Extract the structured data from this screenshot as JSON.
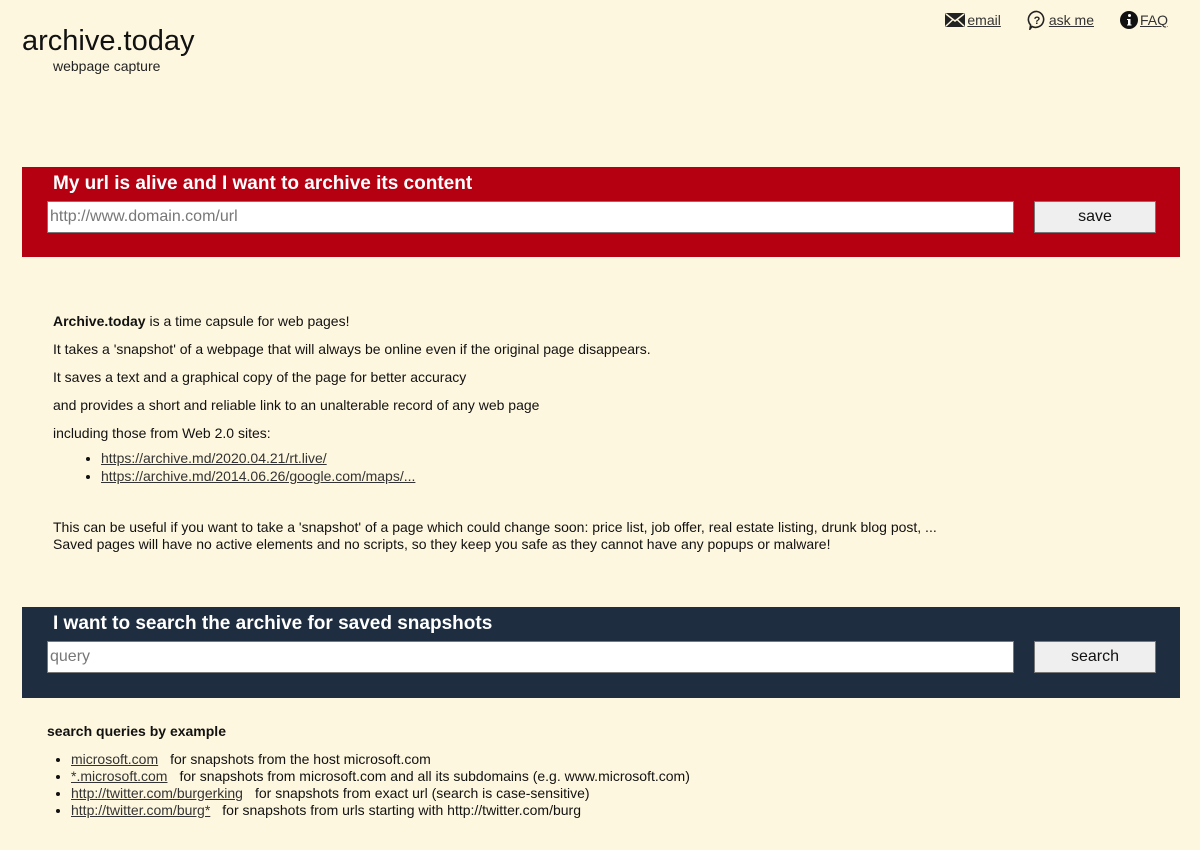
{
  "header": {
    "logo_title": "archive.today",
    "logo_subtitle": "webpage capture",
    "links": [
      {
        "icon": "envelope-icon",
        "label": "email"
      },
      {
        "icon": "question-bubble-icon",
        "label": "ask me"
      },
      {
        "icon": "info-icon",
        "label": "FAQ"
      }
    ]
  },
  "save_panel": {
    "title": "My url is alive and I want to archive its content",
    "input_value": "",
    "input_placeholder": "http://www.domain.com/url",
    "button_label": "save",
    "background_color": "#b50011"
  },
  "about": {
    "intro_bold": "Archive.today",
    "intro_rest": " is a time capsule for web pages!",
    "lines": [
      "It takes a 'snapshot' of a webpage that will always be online even if the original page disappears.",
      "It saves a text and a graphical copy of the page for better accuracy",
      "and provides a short and reliable link to an unalterable record of any web page",
      "including those from Web 2.0 sites:"
    ],
    "example_links": [
      "https://archive.md/2020.04.21/rt.live/",
      "https://archive.md/2014.06.26/google.com/maps/..."
    ],
    "usefulness_line1": "This can be useful if you want to take a 'snapshot' of a page which could change soon: price list, job offer, real estate listing, drunk blog post, ...",
    "usefulness_line2": "Saved pages will have no active elements and no scripts, so they keep you safe as they cannot have any popups or malware!"
  },
  "search_panel": {
    "title": "I want to search the archive for saved snapshots",
    "input_value": "",
    "input_placeholder": "query",
    "button_label": "search",
    "background_color": "#1e2d40"
  },
  "examples": {
    "heading": "search queries by example",
    "items": [
      {
        "query": "microsoft.com",
        "description": "for snapshots from the host microsoft.com"
      },
      {
        "query": "*.microsoft.com",
        "description": "for snapshots from microsoft.com and all its subdomains (e.g. www.microsoft.com)"
      },
      {
        "query": "http://twitter.com/burgerking",
        "description": "for snapshots from exact url (search is case-sensitive)"
      },
      {
        "query": "http://twitter.com/burg*",
        "description": "for snapshots from urls starting with http://twitter.com/burg"
      }
    ]
  }
}
